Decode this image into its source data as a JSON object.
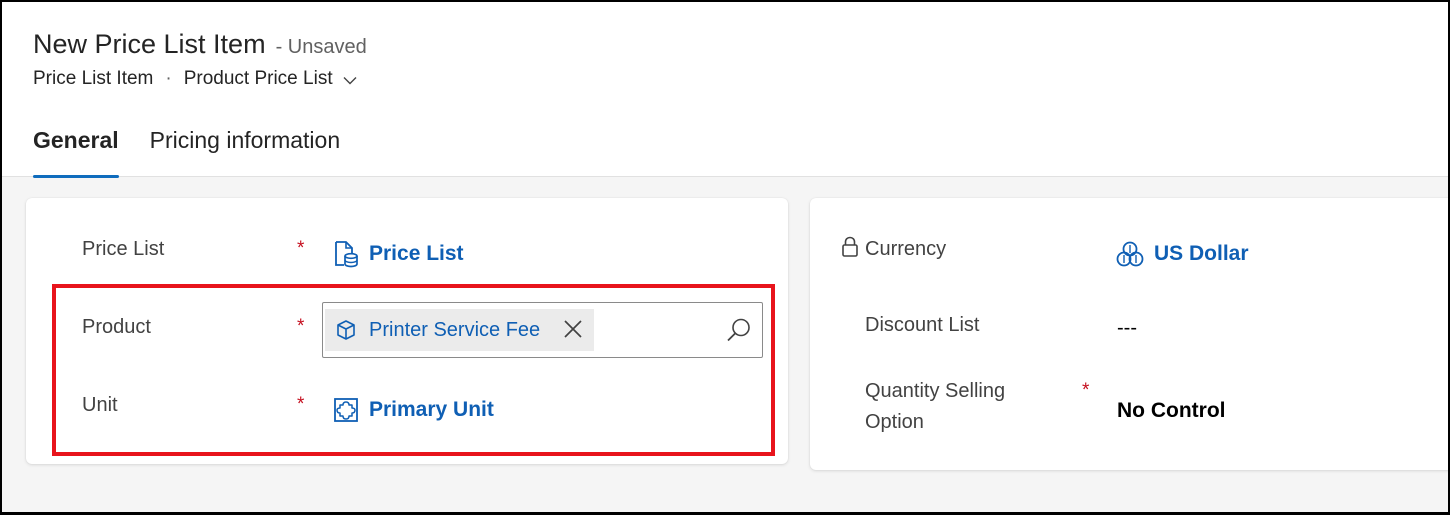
{
  "header": {
    "title": "New Price List Item",
    "status": "- Unsaved",
    "breadcrumb": {
      "entity": "Price List Item",
      "separator": "·",
      "form": "Product Price List"
    }
  },
  "tabs": [
    {
      "label": "General",
      "active": true
    },
    {
      "label": "Pricing information",
      "active": false
    }
  ],
  "left_card": {
    "price_list": {
      "label": "Price List",
      "required": "*",
      "value": "Price List",
      "icon": "document-coins-icon"
    },
    "product": {
      "label": "Product",
      "required": "*",
      "value": "Printer Service Fee",
      "icon": "cube-icon"
    },
    "unit": {
      "label": "Unit",
      "required": "*",
      "value": "Primary Unit",
      "icon": "puzzle-icon"
    }
  },
  "right_card": {
    "currency": {
      "label": "Currency",
      "value": "US Dollar",
      "icon": "currency-coins-icon",
      "locked": true
    },
    "discount_list": {
      "label": "Discount List",
      "value": "---"
    },
    "quantity_selling": {
      "label_line1": "Quantity Selling",
      "label_line2": "Option",
      "required": "*",
      "value": "No Control"
    }
  },
  "colors": {
    "accent": "#0f6cbd",
    "link": "#0f5fb4",
    "required": "#c50f1f",
    "highlight": "#e8141c"
  }
}
